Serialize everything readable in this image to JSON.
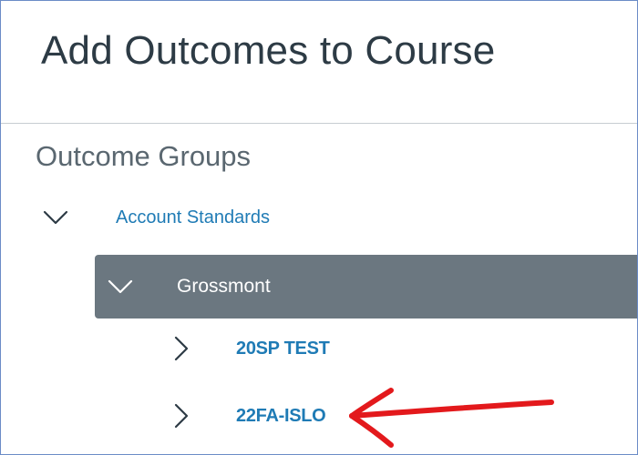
{
  "dialog": {
    "title": "Add Outcomes to Course"
  },
  "outcome_groups": {
    "heading": "Outcome Groups",
    "tree": [
      {
        "label": "Account Standards",
        "expanded": true,
        "icon": "chevron-down-icon",
        "children": [
          {
            "label": "Grossmont",
            "expanded": true,
            "selected": true,
            "icon": "chevron-down-icon",
            "children": [
              {
                "label": "20SP TEST",
                "expanded": false,
                "icon": "chevron-right-icon"
              },
              {
                "label": "22FA-ISLO",
                "expanded": false,
                "icon": "chevron-right-icon"
              }
            ]
          }
        ]
      }
    ]
  },
  "annotation": {
    "type": "arrow",
    "color": "#e3191c",
    "points_to": "22FA-ISLO"
  },
  "colors": {
    "link": "#1f7bb5",
    "selected_bg": "#6b7780",
    "title_text": "#2d3b45",
    "frame_border": "#6b8cc7"
  }
}
